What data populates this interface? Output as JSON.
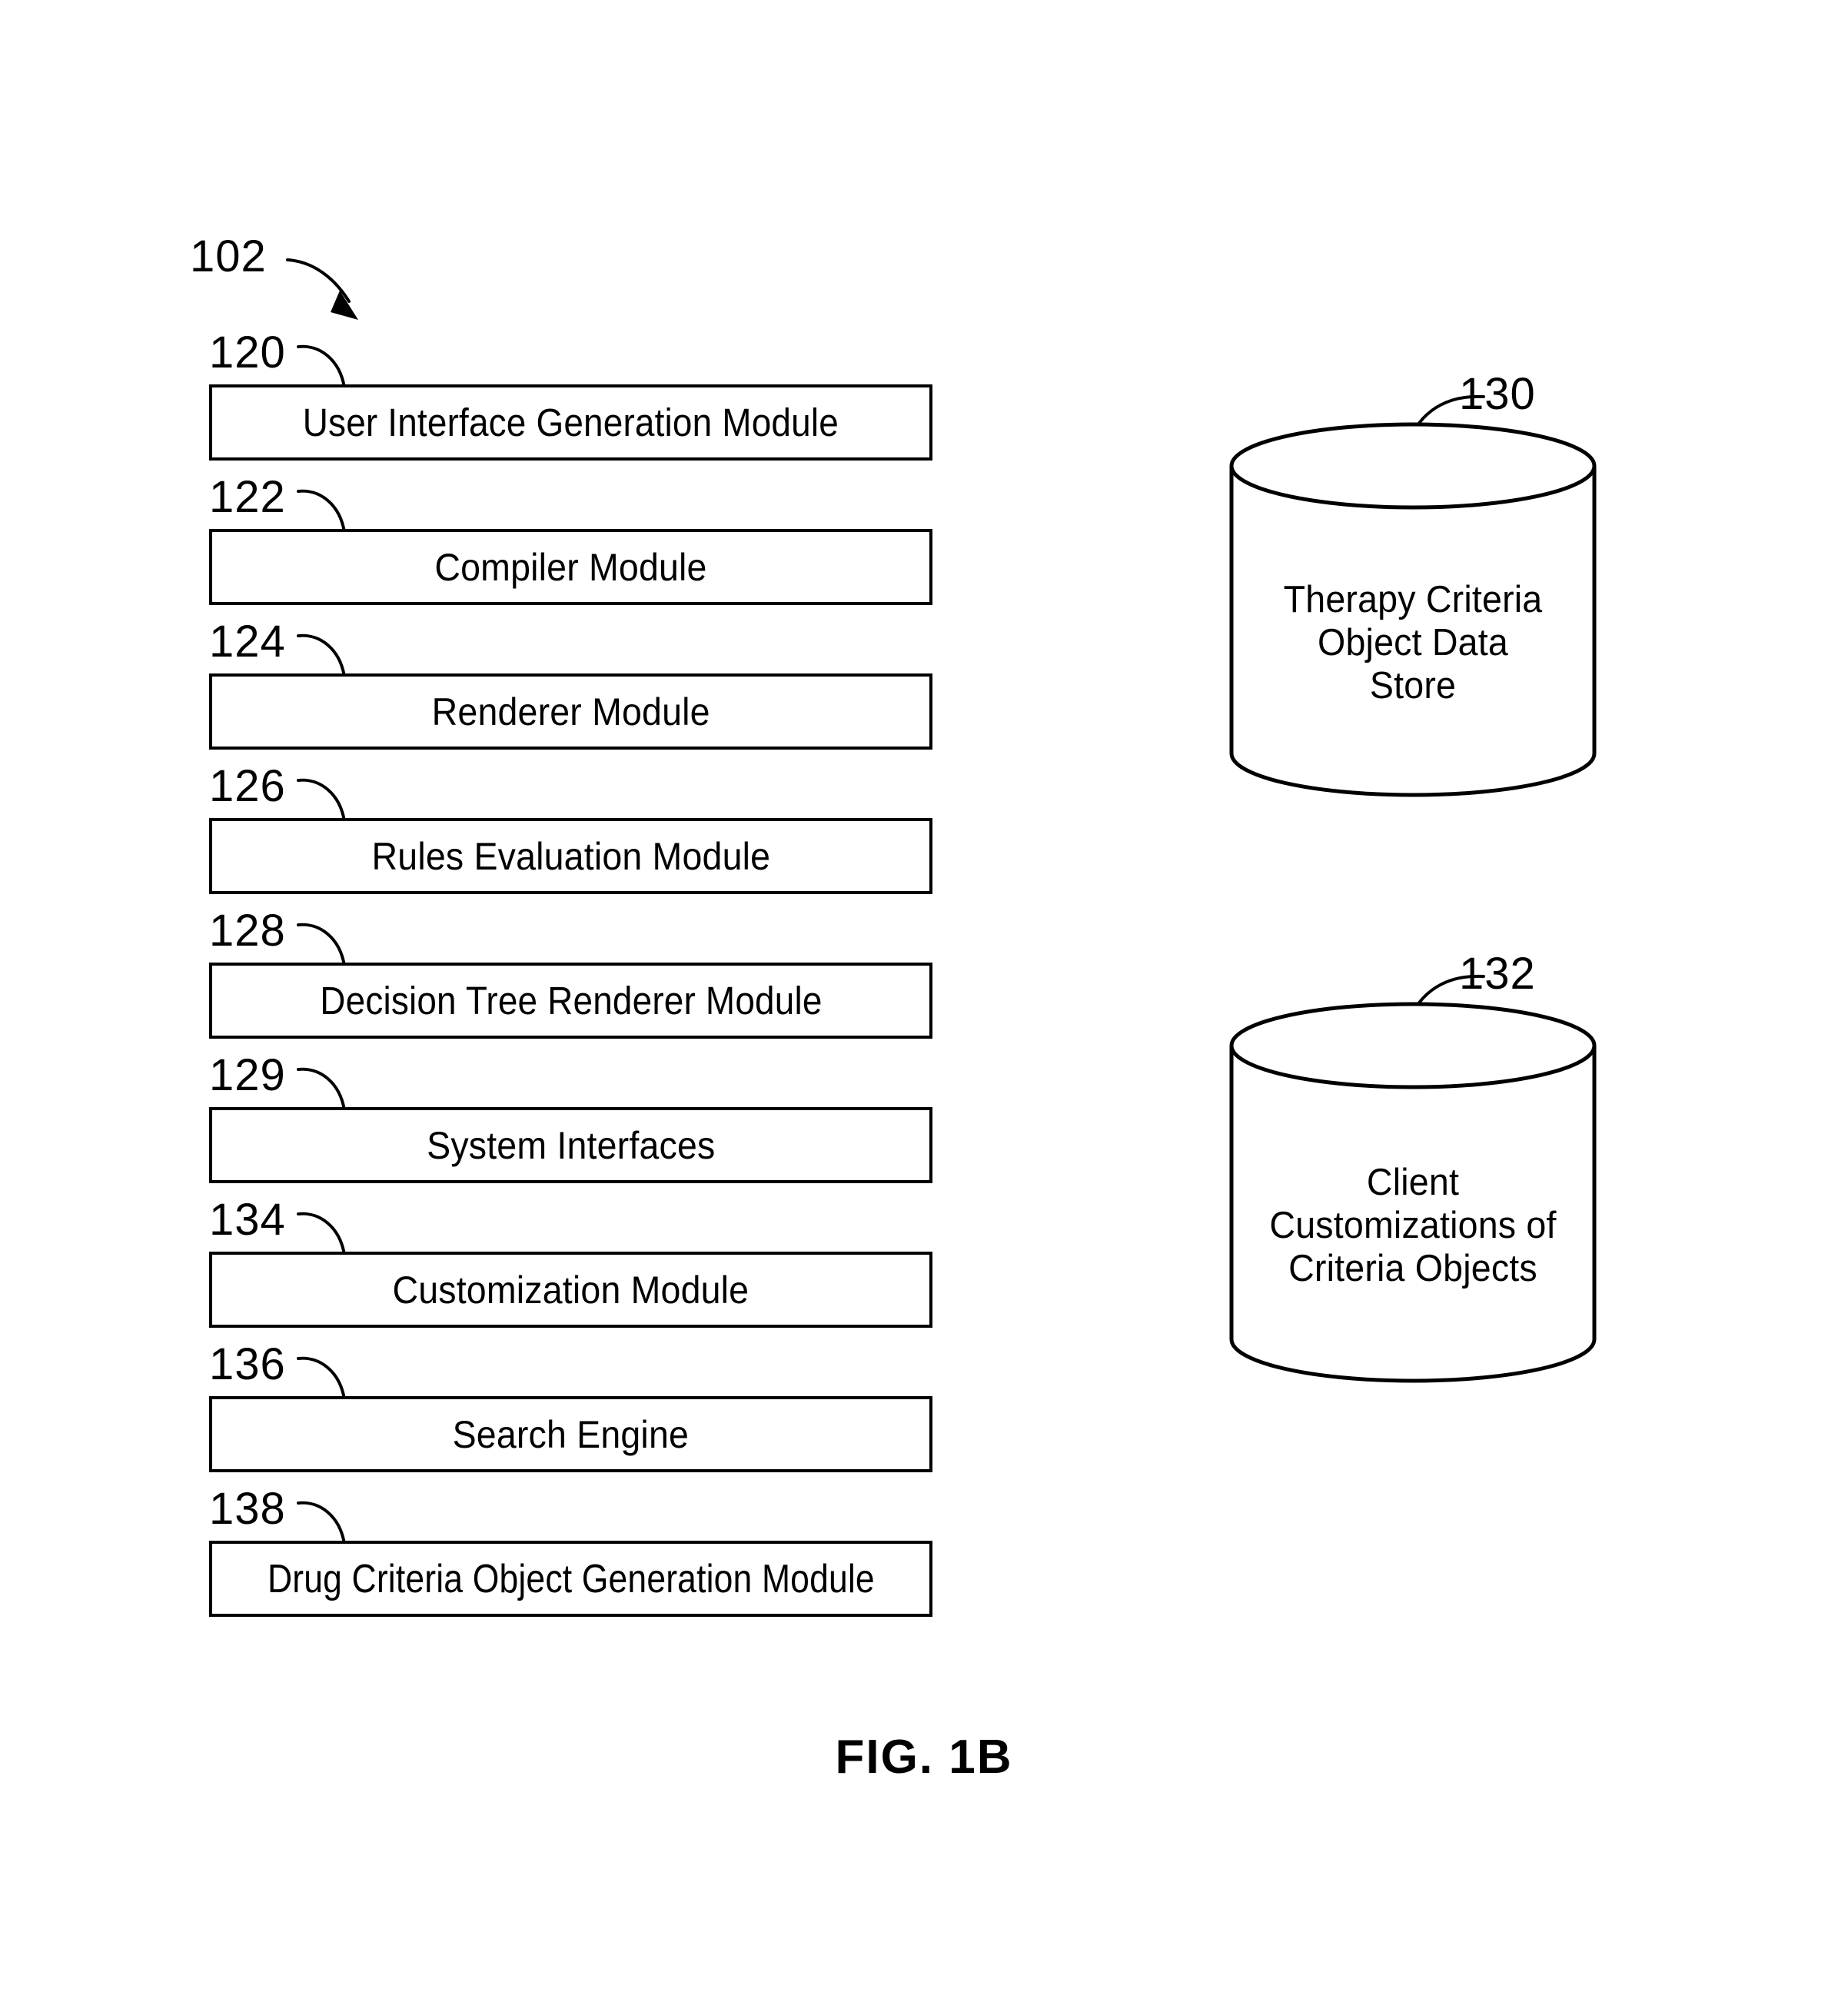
{
  "figure": {
    "caption": "FIG. 1B",
    "system_ref": "102"
  },
  "modules": [
    {
      "ref": "120",
      "label": "User Interface Generation Module"
    },
    {
      "ref": "122",
      "label": "Compiler Module"
    },
    {
      "ref": "124",
      "label": "Renderer Module"
    },
    {
      "ref": "126",
      "label": "Rules Evaluation Module"
    },
    {
      "ref": "128",
      "label": "Decision Tree Renderer Module"
    },
    {
      "ref": "129",
      "label": "System Interfaces"
    },
    {
      "ref": "134",
      "label": "Customization Module"
    },
    {
      "ref": "136",
      "label": "Search Engine"
    },
    {
      "ref": "138",
      "label": "Drug Criteria Object Generation Module"
    }
  ],
  "data_stores": [
    {
      "ref": "130",
      "label": "Therapy Criteria\nObject Data\nStore"
    },
    {
      "ref": "132",
      "label": "Client\nCustomizations of\nCriteria Objects"
    }
  ],
  "colors": {
    "ink": "#000000",
    "paper": "#ffffff"
  }
}
